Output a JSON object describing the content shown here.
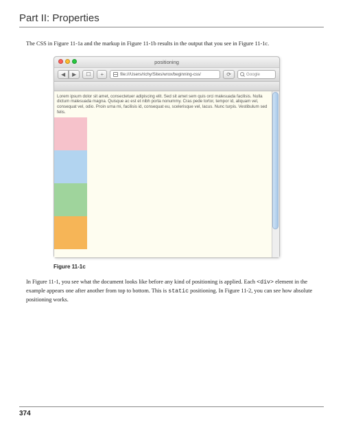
{
  "header": {
    "part_title": "Part II: Properties"
  },
  "intro": "The CSS in Figure 11-1a and the markup in Figure 11-1b results in the output that you see in Figure 11-1c.",
  "browser": {
    "window_title": "positioning",
    "nav_back": "◀",
    "nav_fwd": "▶",
    "bookmark": "☐",
    "add": "+",
    "url": "file:///Users/richy/Sites/wrox/beginning-css/",
    "reload": "⟳",
    "search_placeholder": "Google",
    "lorem": "Lorem ipsum dolor sit amet, consectetuer adipiscing elit. Sed sit amet sem quis orci malesuada facilisis. Nulla dictum malesuada magna. Quisque ac est et nibh porta nonummy. Cras pede tortor, tempor id, aliquam vel, consequat vel, odio. Proin urna mi, facilisis id, consequat eu, scelerisque vel, lacus. Nunc turpis. Vestibulum sed felis."
  },
  "caption": "Figure 11-1c",
  "para2_a": "In Figure 11-1, you see what the document looks like before any kind of positioning is applied. Each ",
  "para2_code1": "<div>",
  "para2_b": " element in the example appears one after another from top to bottom. This is ",
  "para2_code2": "static",
  "para2_c": " positioning. In Figure 11-2, you can see how absolute positioning works.",
  "page_number": "374"
}
